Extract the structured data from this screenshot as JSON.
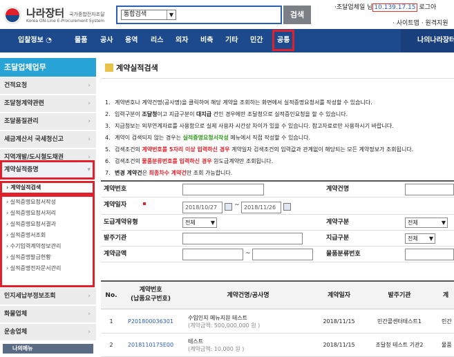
{
  "header": {
    "logo_title": "나라장터",
    "logo_sub": "국가종합전자조달",
    "logo_eng": "Korea ON-Line E-Procurement System",
    "search_select_value": "통합검색",
    "search_button": "검색",
    "user_prefix": "·조달업체일 님",
    "user_ip": "10.139.17.15",
    "logout": "로그아",
    "links": "· 사이트맵 · 원격지원"
  },
  "gnb": {
    "items": [
      "입찰정보",
      "물품",
      "공사",
      "용역",
      "리스",
      "외자",
      "비축",
      "기타",
      "민간",
      "공통"
    ],
    "selected": "공통",
    "right": "나의나라장터"
  },
  "sidebar": {
    "title": "조달업체업무",
    "menus": [
      "건적요청",
      "조달청계약관련",
      "조달품질관리",
      "세금계산서 국세청신고",
      "지역개발/도시철도채권",
      "계약실적증명"
    ],
    "submenus": [
      "› 계약실적검색",
      "› 실적증명요청서작성",
      "› 실적증명요청서처리",
      "› 실적증명요청서결과",
      "› 실적증명서조회",
      "› 수기입력계약정보관리",
      "› 실적증명발급현황",
      "› 실적증명전자문서관리"
    ],
    "menus_after": [
      "인지세납부정보조회",
      "화물업체",
      "운송업체"
    ],
    "mymenu": "나의메뉴"
  },
  "content": {
    "title": "계약실적검색",
    "notes": [
      {
        "num": "1.",
        "parts": [
          {
            "t": "계약번호나 계약건명(공사명)을 클릭하여 해당 계약을 조회하는 화면에서 실적증명요청서를 작성할 수 있습니다.",
            "s": ""
          }
        ]
      },
      {
        "num": "2.",
        "parts": [
          {
            "t": "입력구분이 ",
            "s": ""
          },
          {
            "t": "조달청",
            "s": "b"
          },
          {
            "t": "이고 지급구분이 ",
            "s": ""
          },
          {
            "t": "대지급",
            "s": "b"
          },
          {
            "t": " 건인 경우에만 조달청으로 실적증인요청을 할 수 있습니다.",
            "s": ""
          }
        ]
      },
      {
        "num": "3.",
        "parts": [
          {
            "t": "지급청보는 외부연계자료를 사용함으로 실제 사용자 시간상 차이가 있을 수 있습니다. 참고자료로만 사용하시기 바랍니다.",
            "s": ""
          }
        ]
      },
      {
        "num": "4.",
        "parts": [
          {
            "t": "계약이 검색되지 않는 경우는 ",
            "s": ""
          },
          {
            "t": "실적증명요청서작성",
            "s": "grn"
          },
          {
            "t": " 메뉴에서 직접 작성할 수 있습니다.",
            "s": ""
          }
        ]
      },
      {
        "num": "5.",
        "parts": [
          {
            "t": "검색조건의 ",
            "s": ""
          },
          {
            "t": "계약번호를 5자리 이상 입력하신 경우",
            "s": "red"
          },
          {
            "t": " 계약일자 검색조건의 입력값과 관계없이 해당되는 모든 계약정보가 조회됩니다.",
            "s": ""
          }
        ]
      },
      {
        "num": "6.",
        "parts": [
          {
            "t": "검색조건의 ",
            "s": ""
          },
          {
            "t": "물품분류번호를 입력하신 경우",
            "s": "red"
          },
          {
            "t": " 원도급계약만 조회됩니다.",
            "s": ""
          }
        ]
      },
      {
        "num": "7.",
        "parts": [
          {
            "t": "변경 계약건",
            "s": "b"
          },
          {
            "t": "은 ",
            "s": ""
          },
          {
            "t": "최종차수 계약건",
            "s": "red"
          },
          {
            "t": "만 조회 가능합니다.",
            "s": ""
          }
        ]
      }
    ]
  },
  "form": {
    "contract_no_label": "계약번호",
    "contract_name_label": "계약건명",
    "contract_date_label": "계약일자",
    "date_from": "2018/10/27",
    "date_sep": "~",
    "date_to": "2018/11/26",
    "subcontract_type_label": "도급계약유형",
    "subcontract_type_value": "전체",
    "contract_type_label": "계약구분",
    "contract_type_value": "전체",
    "agency_label": "발주기관",
    "payment_type_label": "지급구분",
    "payment_type_value": "전체",
    "amount_label": "계약금액",
    "amount_sep": "~",
    "category_label": "물품분류번호"
  },
  "table": {
    "headers": [
      "No.",
      "계약번호\n(납품요구번호)",
      "계약건명/공사명",
      "계약일자",
      "발주기관",
      "계"
    ],
    "rows": [
      {
        "no": "1",
        "contract_no": "P201800036301",
        "name": "수입인지 메뉴지원 테스트",
        "amount": "(계약금액: 500,000,000 원 )",
        "date": "2018/11/15",
        "agency": "민간콜센터테스트1",
        "extra": "민간"
      },
      {
        "no": "2",
        "contract_no": "2018110175E00",
        "name": "테스트",
        "amount": "(계약금액: 10,000 원 )",
        "date": "2018/11/15",
        "agency": "조달청 테스트 기관2",
        "extra": "물품"
      }
    ]
  }
}
